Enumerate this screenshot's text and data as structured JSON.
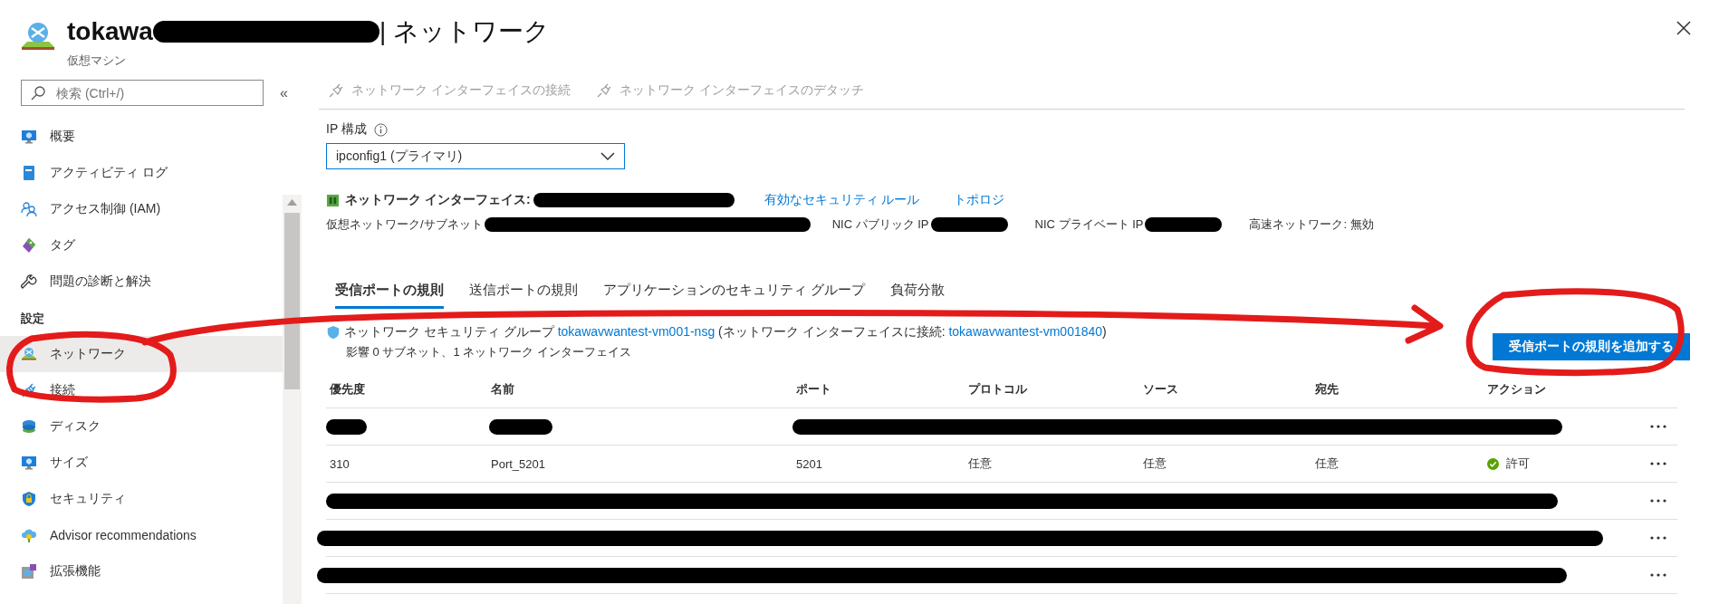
{
  "header": {
    "title": "tokawa",
    "title_suffix": "| ネットワーク",
    "subtitle": "仮想マシン"
  },
  "sidebar": {
    "search": {
      "placeholder": "検索 (Ctrl+/)"
    },
    "collapse": "«",
    "items": [
      {
        "label": "概要",
        "selected": false
      },
      {
        "label": "アクティビティ ログ",
        "selected": false
      },
      {
        "label": "アクセス制御 (IAM)",
        "selected": false
      },
      {
        "label": "タグ",
        "selected": false
      },
      {
        "label": "問題の診断と解決",
        "selected": false
      }
    ],
    "section": "設定",
    "settings_items": [
      {
        "label": "ネットワーク",
        "selected": true
      },
      {
        "label": "接続",
        "selected": false
      },
      {
        "label": "ディスク",
        "selected": false
      },
      {
        "label": "サイズ",
        "selected": false
      },
      {
        "label": "セキュリティ",
        "selected": false
      },
      {
        "label": "Advisor recommendations",
        "selected": false
      },
      {
        "label": "拡張機能",
        "selected": false
      }
    ]
  },
  "toolbar": [
    {
      "label": "ネットワーク インターフェイスの接続",
      "disabled": true
    },
    {
      "label": "ネットワーク インターフェイスのデタッチ",
      "disabled": true
    }
  ],
  "ip_config": {
    "label": "IP 構成",
    "value": "ipconfig1 (プライマリ)"
  },
  "nic": {
    "label": "ネットワーク インターフェイス:",
    "links": [
      "有効なセキュリティ ルール",
      "トポロジ"
    ]
  },
  "details": [
    {
      "kind": "redacted",
      "label": "仮想ネットワーク/サブネット"
    },
    {
      "kind": "redacted",
      "label": "NIC パブリック IP"
    },
    {
      "kind": "redacted",
      "label": "NIC プライベート IP"
    },
    {
      "kind": "text",
      "label": "高速ネットワーク: 無効"
    }
  ],
  "tabs": [
    {
      "label": "受信ポートの規則",
      "selected": true
    },
    {
      "label": "送信ポートの規則",
      "selected": false
    },
    {
      "label": "アプリケーションのセキュリティ グループ",
      "selected": false
    },
    {
      "label": "負荷分散",
      "selected": false
    }
  ],
  "nsg": {
    "label": "ネットワーク セキュリティ グループ",
    "link": "tokawavwantest-vm001-nsg",
    "attached": "(ネットワーク インターフェイスに接続: ",
    "attached_link": "tokawavwantest-vm001840",
    "attached_end": ")",
    "impact": "影響 0 サブネット、1 ネットワーク インターフェイス"
  },
  "add_button": "受信ポートの規則を追加する",
  "table": {
    "columns": [
      "優先度",
      "名前",
      "ポート",
      "プロトコル",
      "ソース",
      "宛先",
      "アクション"
    ],
    "rows": [
      {
        "kind": "redacted"
      },
      {
        "kind": "rule",
        "cells": [
          "310",
          "Port_5201",
          "5201",
          "任意",
          "任意",
          "任意",
          "許可"
        ]
      },
      {
        "kind": "redacted"
      },
      {
        "kind": "redacted"
      },
      {
        "kind": "redacted"
      }
    ]
  }
}
